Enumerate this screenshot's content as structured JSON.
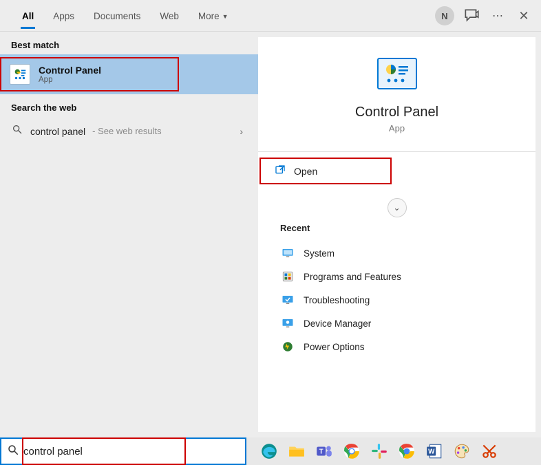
{
  "header": {
    "tabs": [
      {
        "label": "All",
        "active": true
      },
      {
        "label": "Apps",
        "active": false
      },
      {
        "label": "Documents",
        "active": false
      },
      {
        "label": "Web",
        "active": false
      },
      {
        "label": "More",
        "active": false,
        "dropdown": true
      }
    ],
    "avatar_initial": "N"
  },
  "left": {
    "best_match_label": "Best match",
    "best_match": {
      "title": "Control Panel",
      "subtitle": "App"
    },
    "search_web_label": "Search the web",
    "web_result": {
      "query": "control panel",
      "hint": "See web results"
    }
  },
  "right": {
    "title": "Control Panel",
    "subtitle": "App",
    "open_label": "Open",
    "recent_label": "Recent",
    "recent_items": [
      {
        "label": "System",
        "icon": "system"
      },
      {
        "label": "Programs and Features",
        "icon": "programs"
      },
      {
        "label": "Troubleshooting",
        "icon": "troubleshoot"
      },
      {
        "label": "Device Manager",
        "icon": "device"
      },
      {
        "label": "Power Options",
        "icon": "power"
      }
    ]
  },
  "search": {
    "value": "control panel"
  },
  "colors": {
    "accent": "#0078d4",
    "highlight_red": "#cc0000",
    "selected_bg": "#a4c8e8"
  }
}
